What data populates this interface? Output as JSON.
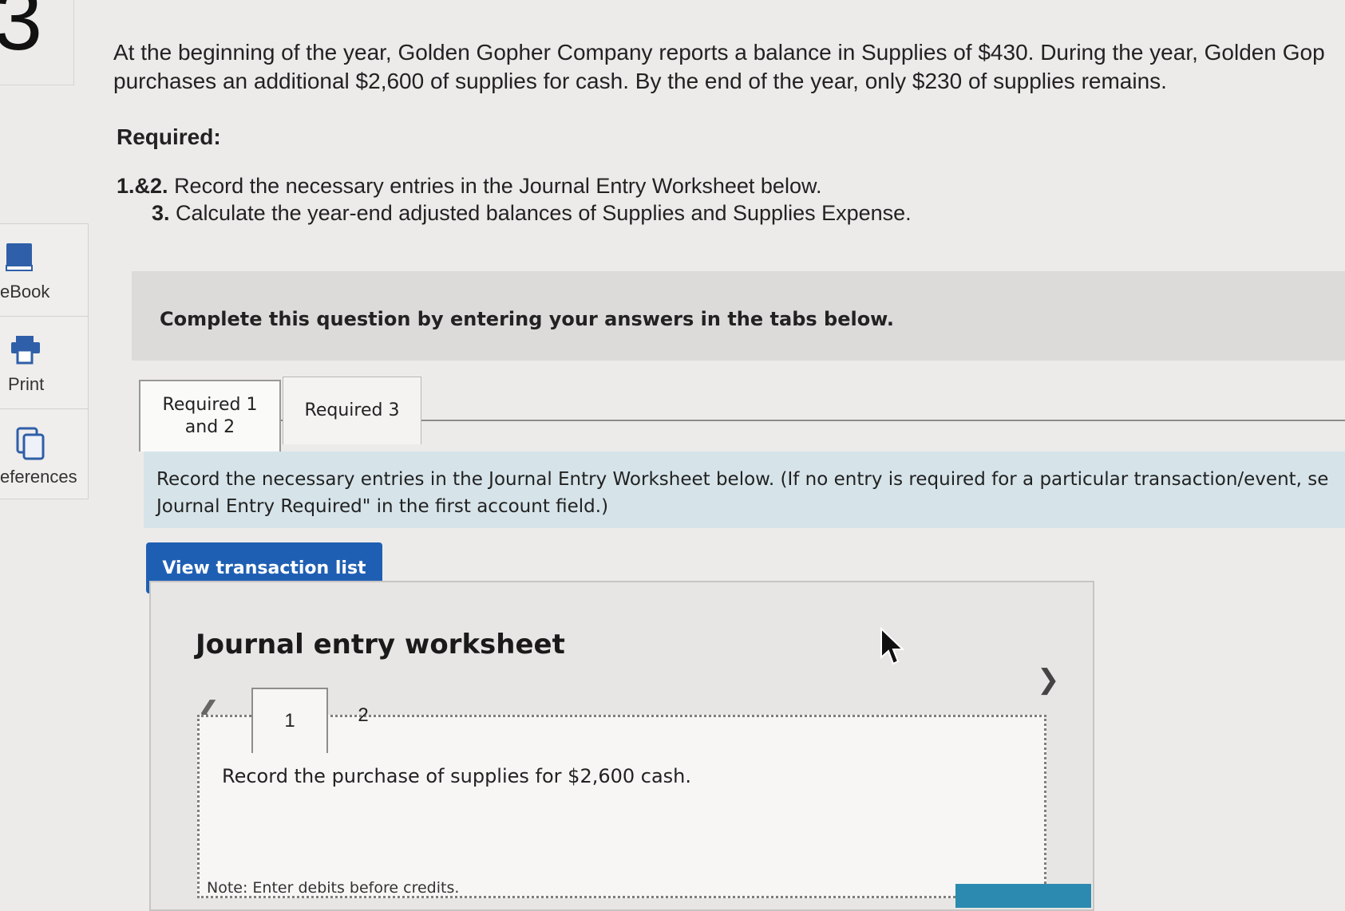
{
  "question_number": "3",
  "sidebar": {
    "items": [
      {
        "label": "eBook",
        "icon": "book-icon"
      },
      {
        "label": "Print",
        "icon": "printer-icon"
      },
      {
        "label": "eferences",
        "icon": "references-icon"
      }
    ]
  },
  "problem": {
    "line1": "At the beginning of the year, Golden Gopher Company reports a balance in Supplies of $430. During the year, Golden Gop",
    "line2": "purchases an additional $2,600 of supplies for cash. By the end of the year, only $230 of supplies remains.",
    "required_heading": "Required:",
    "items": [
      {
        "num": "1.&2.",
        "text": "Record the necessary entries in the Journal Entry Worksheet below."
      },
      {
        "num": "3.",
        "text": "Calculate the year-end adjusted balances of Supplies and Supplies Expense."
      }
    ]
  },
  "instruction": "Complete this question by entering your answers in the tabs below.",
  "tabs": [
    {
      "label_line1": "Required 1",
      "label_line2": "and 2",
      "active": true
    },
    {
      "label_line1": "Required 3",
      "label_line2": "",
      "active": false
    }
  ],
  "tab_instruction": {
    "line1": "Record the necessary entries in the Journal Entry Worksheet below. (If no entry is required for a particular transaction/event, se",
    "line2": "Journal Entry Required\" in the first account field.)"
  },
  "view_transactions_button": "View transaction list",
  "worksheet": {
    "title": "Journal entry worksheet",
    "pages": [
      "1",
      "2"
    ],
    "current_page": "1",
    "description": "Record the purchase of supplies for $2,600 cash.",
    "note": "Note: Enter debits before credits."
  },
  "colors": {
    "button_blue": "#1f5fb3",
    "instruction_bg": "#d6e4ea",
    "header_bg": "#dcdbda"
  }
}
